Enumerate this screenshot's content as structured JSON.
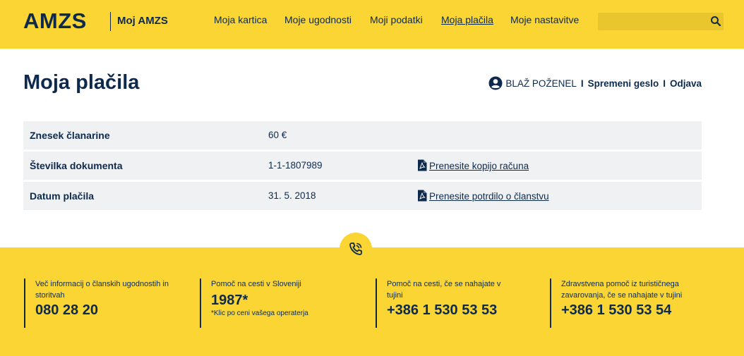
{
  "header": {
    "logo": "AMZS",
    "subbrand": "Moj AMZS",
    "nav": [
      {
        "label": "Moja kartica"
      },
      {
        "label": "Moje ugodnosti"
      },
      {
        "label": "Moji podatki"
      },
      {
        "label": "Moja plačila"
      },
      {
        "label": "Moje nastavitve"
      }
    ],
    "search_value": ""
  },
  "main": {
    "title": "Moja plačila",
    "user": {
      "name": "BLAŽ POŽENEL",
      "sep": "I",
      "change_password": "Spremeni geslo",
      "logout": "Odjava"
    },
    "rows": [
      {
        "label": "Znesek članarine",
        "value": "60 €",
        "link": ""
      },
      {
        "label": "Številka dokumenta",
        "value": "1-1-1807989",
        "link": "Prenesite kopijo računa"
      },
      {
        "label": "Datum plačila",
        "value": "31. 5. 2018",
        "link": "Prenesite potrdilo o članstvu"
      }
    ]
  },
  "footer": {
    "columns": [
      {
        "text": "Več informacij o članskih ugodnostih in storitvah",
        "number": "080 28 20",
        "note": ""
      },
      {
        "text": "Pomoč na cesti v Sloveniji",
        "number": "1987*",
        "note": "*Klic po ceni vašega operaterja"
      },
      {
        "text": "Pomoč na cesti, če se nahajate v tujini",
        "number": "+386 1 530 53 53",
        "note": ""
      },
      {
        "text": "Zdravstvena pomoč iz turističnega zavarovanja, če se nahajate v tujini",
        "number": "+386 1 530 53 54",
        "note": ""
      }
    ]
  },
  "colors": {
    "brand_yellow": "#fbd533",
    "brand_navy": "#0d2a4d",
    "row_bg": "#f0f1f3"
  },
  "icons": {
    "search": "search-icon",
    "user": "user-icon",
    "pdf": "pdf-icon",
    "phone": "phone-icon"
  }
}
